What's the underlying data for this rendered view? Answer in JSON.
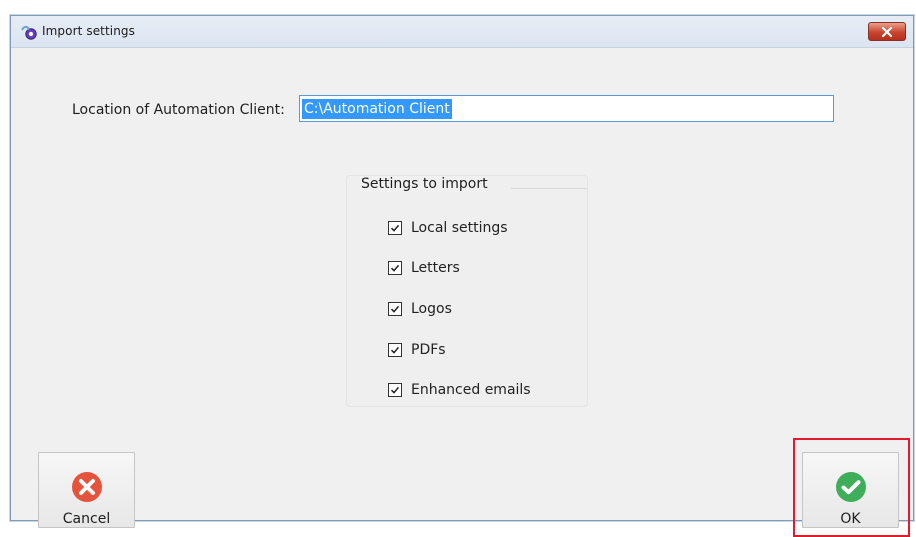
{
  "window": {
    "title": "Import settings"
  },
  "icons": {
    "app_icon": "import-settings-icon",
    "close_icon": "close-icon",
    "cancel_icon": "cancel-x-icon",
    "ok_icon": "ok-check-icon",
    "checkbox_icon": "checkbox-checked-icon"
  },
  "form": {
    "location_label": "Location of Automation Client:",
    "location_value": "C:\\Automation Client"
  },
  "settings_group": {
    "title": "Settings to import",
    "items": [
      {
        "label": "Local settings",
        "checked": true
      },
      {
        "label": "Letters",
        "checked": true
      },
      {
        "label": "Logos",
        "checked": true
      },
      {
        "label": "PDFs",
        "checked": true
      },
      {
        "label": "Enhanced emails",
        "checked": true
      }
    ]
  },
  "buttons": {
    "cancel_label": "Cancel",
    "ok_label": "OK"
  },
  "colors": {
    "cancel_accent": "#e5533d",
    "ok_accent": "#3fae5b",
    "highlight": "#e21b2c",
    "selection": "#3399ff"
  }
}
